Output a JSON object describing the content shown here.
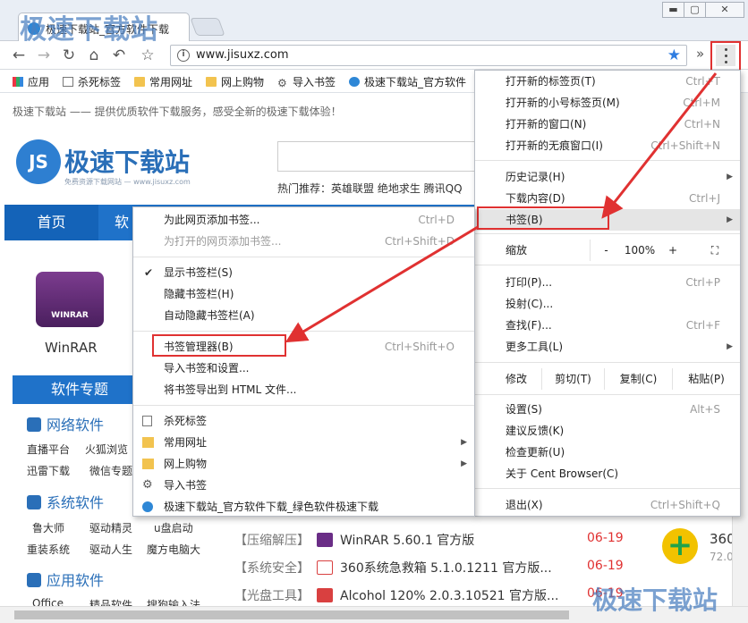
{
  "window": {
    "watermark_top": "极速下载站",
    "watermark_bottom": "极速下载站",
    "tab_title": "极速下载站_官方软件下载",
    "minimize": "▬",
    "maximize": "▢",
    "close": "✕"
  },
  "toolbar": {
    "back": "←",
    "forward": "→",
    "reload": "↻",
    "home": "⌂",
    "undo": "↶",
    "bookmark_outline": "☆",
    "url": "www.jisuxz.com",
    "info": "i",
    "star": "★",
    "ext": "»"
  },
  "bookmarks_bar": {
    "items": [
      {
        "label": "应用",
        "icon": "apps-icon"
      },
      {
        "label": "杀死标签",
        "icon": "page-icon"
      },
      {
        "label": "常用网址",
        "icon": "folder-icon"
      },
      {
        "label": "网上购物",
        "icon": "folder-icon"
      },
      {
        "label": "导入书签",
        "icon": "gear-icon"
      },
      {
        "label": "极速下载站_官方软件",
        "icon": "globe-icon"
      }
    ]
  },
  "page": {
    "welcome": "极速下载站 —— 提供优质软件下载服务，感受全新的极速下载体验！",
    "logo_mark": "JS",
    "logo_text": "极速下载站",
    "logo_sub": "免费资源下载网站 — www.jisuxz.com",
    "hot": "热门推荐：英雄联盟  绝地求生  腾讯QQ",
    "nav_home": "首页",
    "nav_2": "软",
    "winrar_badge": "WINRAR",
    "winrar_label": "WinRAR",
    "special": "软件专题",
    "cat_network": "网络软件",
    "cat_system": "系统软件",
    "cat_apps": "应用软件",
    "items": {
      "live": "直播平台",
      "firefox": "火狐浏览",
      "thunder": "迅雷下载",
      "wechat": "微信专题",
      "ludashi": "鲁大师",
      "driver": "驱动精灵",
      "udisk": "u盘启动",
      "reinstall": "重装系统",
      "driverlife": "驱动人生",
      "magic": "魔方电脑大",
      "office": "Office",
      "jingpin": "精品软件",
      "input": "搜狗输入法"
    },
    "downloads": [
      {
        "category": "【压缩解压】",
        "name": "WinRAR 5.60.1 官方版",
        "date": "06-19",
        "color": "#6a2d86"
      },
      {
        "category": "【系统安全】",
        "name": "360系统急救箱 5.1.0.1211 官方版...",
        "date": "06-19",
        "color": "#d94040"
      },
      {
        "category": "【光盘工具】",
        "name": "Alcohol 120% 2.0.3.10521 官方版...",
        "date": "06-19",
        "color": "#d94040"
      }
    ],
    "side_num": "360",
    "side_sub": "72.0"
  },
  "main_menu": {
    "new_tab": "打开新的标签页(T)",
    "new_tab_sc": "Ctrl+T",
    "new_small_tab": "打开新的小号标签页(M)",
    "new_small_tab_sc": "Ctrl+M",
    "new_window": "打开新的窗口(N)",
    "new_window_sc": "Ctrl+N",
    "incognito": "打开新的无痕窗口(I)",
    "incognito_sc": "Ctrl+Shift+N",
    "history": "历史记录(H)",
    "downloads": "下载内容(D)",
    "downloads_sc": "Ctrl+J",
    "bookmarks": "书签(B)",
    "zoom": "缩放",
    "zoom_minus": "-",
    "zoom_value": "100%",
    "zoom_plus": "+",
    "fullscreen": "⛶",
    "print": "打印(P)...",
    "print_sc": "Ctrl+P",
    "cast": "投射(C)...",
    "find": "查找(F)...",
    "find_sc": "Ctrl+F",
    "more_tools": "更多工具(L)",
    "edit": "修改",
    "cut": "剪切(T)",
    "copy": "复制(C)",
    "paste": "粘贴(P)",
    "settings": "设置(S)",
    "settings_sc": "Alt+S",
    "feedback": "建议反馈(K)",
    "check_update": "检查更新(U)",
    "about": "关于 Cent Browser(C)",
    "exit": "退出(X)",
    "exit_sc": "Ctrl+Shift+Q"
  },
  "bookmark_menu": {
    "add_page": "为此网页添加书签...",
    "add_page_sc": "Ctrl+D",
    "add_open": "为打开的网页添加书签...",
    "add_open_sc": "Ctrl+Shift+D",
    "show_bar": "显示书签栏(S)",
    "hide_bar": "隐藏书签栏(H)",
    "auto_hide": "自动隐藏书签栏(A)",
    "manager": "书签管理器(B)",
    "manager_sc": "Ctrl+Shift+O",
    "import": "导入书签和设置...",
    "export": "将书签导出到 HTML 文件...",
    "items": [
      {
        "label": "杀死标签",
        "icon": "page-icon",
        "submenu": false
      },
      {
        "label": "常用网址",
        "icon": "folder-icon",
        "submenu": true
      },
      {
        "label": "网上购物",
        "icon": "folder-icon",
        "submenu": true
      },
      {
        "label": "导入书签",
        "icon": "gear-icon",
        "submenu": false
      },
      {
        "label": "极速下载站_官方软件下载_绿色软件极速下载",
        "icon": "globe-icon",
        "submenu": false
      }
    ],
    "check": "✔",
    "arrow": "▶"
  },
  "colors": {
    "annotation_red": "#e03131",
    "brand_blue": "#1f72c9",
    "star_blue": "#2f7de1",
    "date_red": "#e03131"
  }
}
